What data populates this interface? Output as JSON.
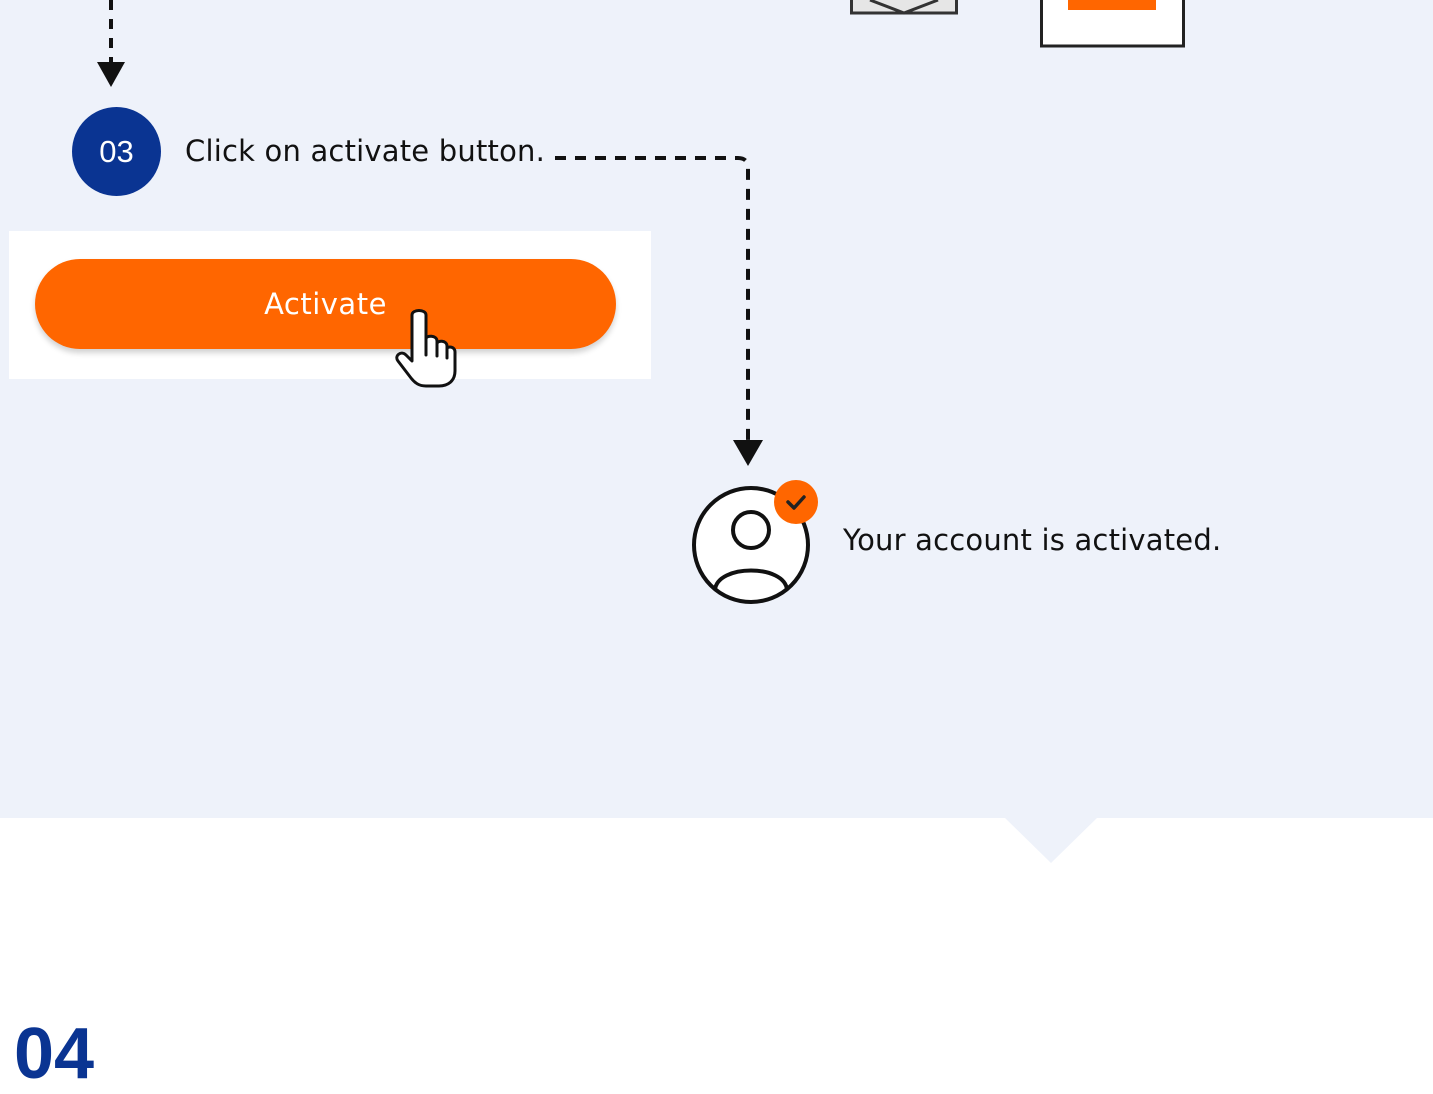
{
  "step": {
    "number": "03",
    "instruction": "Click on activate button."
  },
  "button": {
    "label": "Activate"
  },
  "result": {
    "text": "Your account is activated."
  },
  "next_step": {
    "number": "04"
  },
  "icons": {
    "cursor": "hand-pointer-icon",
    "user": "user-circle-icon",
    "check": "check-icon",
    "envelope": "envelope-icon",
    "document": "document-icon"
  },
  "colors": {
    "brand_blue": "#0a3492",
    "accent_orange": "#ff6600",
    "panel_background": "#eef2fa",
    "text": "#111111"
  }
}
